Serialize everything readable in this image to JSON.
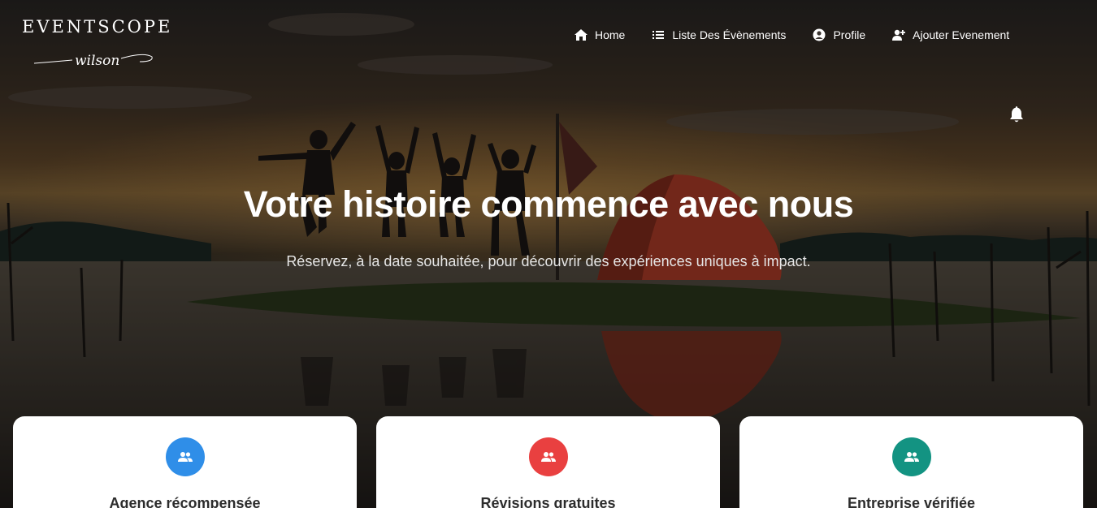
{
  "header": {
    "brand": "EVENTSCOPE",
    "brand_script": "wilson",
    "nav": [
      {
        "label": "Home",
        "icon": "home-icon"
      },
      {
        "label": "Liste Des Évènements",
        "icon": "list-icon"
      },
      {
        "label": "Profile",
        "icon": "user-circle-icon"
      },
      {
        "label": "Ajouter Evenement",
        "icon": "user-plus-icon"
      }
    ],
    "notification_icon": "bell-icon"
  },
  "hero": {
    "title": "Votre histoire commence avec nous",
    "subtitle": "Réservez, à la date souhaitée, pour découvrir des expériences uniques à impact."
  },
  "features": [
    {
      "title": "Agence récompensée",
      "icon": "users-icon",
      "color": "#2f8ee8"
    },
    {
      "title": "Révisions gratuites",
      "icon": "users-icon",
      "color": "#e94040"
    },
    {
      "title": "Entreprise vérifiée",
      "icon": "users-icon",
      "color": "#139382"
    }
  ]
}
